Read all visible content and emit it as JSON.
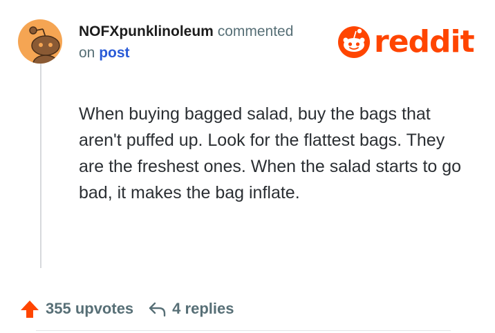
{
  "comment": {
    "username": "NOFXpunklinoleum",
    "action_text": "commented",
    "on_text": "on",
    "post_link": "post",
    "body": "When buying bagged salad, buy the bags that aren't puffed up. Look for the flattest bags. They are the freshest ones. When the salad starts to go bad, it makes the bag inflate."
  },
  "brand": {
    "logo_text": "reddit",
    "logo_icon": "reddit-snoo-icon",
    "color": "#ff4500"
  },
  "stats": {
    "upvotes_label": "355 upvotes",
    "replies_label": "4 replies",
    "upvote_icon": "upvote-arrow-icon",
    "reply_icon": "reply-arrow-icon",
    "upvote_color": "#ff4500"
  },
  "avatar": {
    "icon": "snoo-avatar-icon",
    "background": "#f5a553"
  }
}
